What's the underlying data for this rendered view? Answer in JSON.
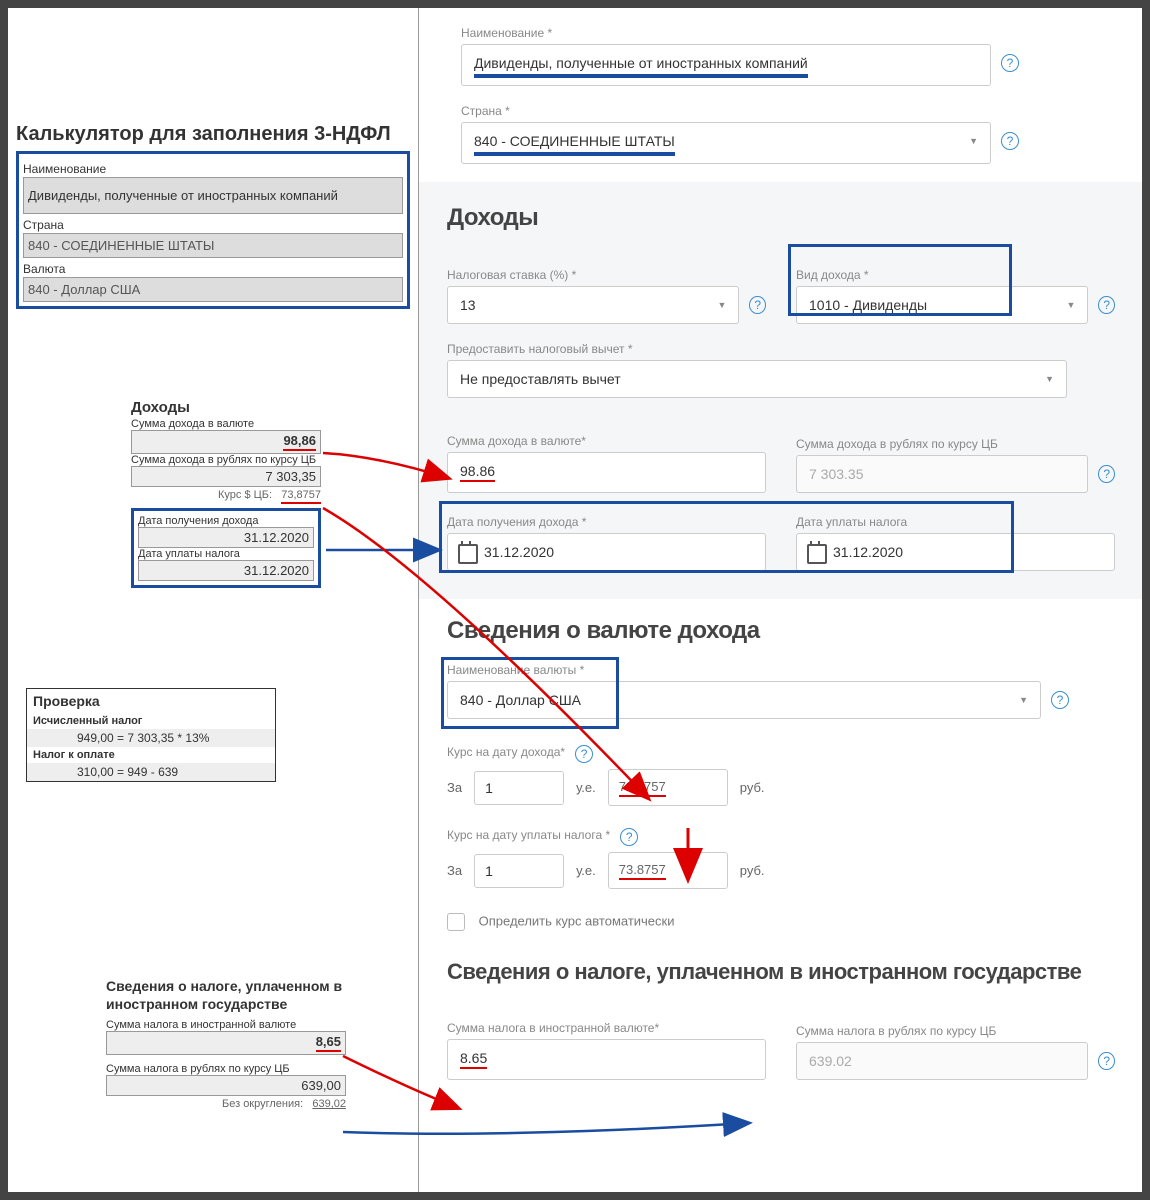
{
  "left": {
    "title": "Калькулятор для заполнения 3-НДФЛ",
    "name_lbl": "Наименование",
    "name_val": "Дивиденды, полученные от иностранных компаний",
    "country_lbl": "Страна",
    "country_val": "840 - СОЕДИНЕННЫЕ ШТАТЫ",
    "currency_lbl": "Валюта",
    "currency_val": "840 - Доллар США",
    "income_h": "Доходы",
    "sum_cur_lbl": "Сумма дохода в валюте",
    "sum_cur_val": "98,86",
    "sum_rub_lbl": "Сумма дохода в рублях по курсу ЦБ",
    "sum_rub_val": "7 303,35",
    "rate_lbl": "Курс $ ЦБ:",
    "rate_val": "73,8757",
    "date_in_lbl": "Дата получения дохода",
    "date_in_val": "31.12.2020",
    "date_pay_lbl": "Дата уплаты налога",
    "date_pay_val": "31.12.2020",
    "check_h": "Проверка",
    "check_calc_lbl": "Исчисленный налог",
    "check_calc": "949,00  =  7 303,35 * 13%",
    "check_due_lbl": "Налог к оплате",
    "check_due": "310,00  =  949 - 639",
    "tax_h": "Сведения о налоге, уплаченном в иностранном государстве",
    "tax_cur_lbl": "Сумма налога в иностранной валюте",
    "tax_cur_val": "8,65",
    "tax_rub_lbl": "Сумма налога в рублях по курсу ЦБ",
    "tax_rub_val": "639,00",
    "tax_noround_lbl": "Без округления:",
    "tax_noround_val": "639,02"
  },
  "right": {
    "name_lbl": "Наименование *",
    "name_val": "Дивиденды, полученные от иностранных компаний",
    "country_lbl": "Страна *",
    "country_val": "840 - СОЕДИНЕННЫЕ ШТАТЫ",
    "income_h": "Доходы",
    "rate_pct_lbl": "Налоговая ставка (%) *",
    "rate_pct_val": "13",
    "kind_lbl": "Вид дохода *",
    "kind_val": "1010 - Дивиденды",
    "deduct_lbl": "Предоставить налоговый вычет *",
    "deduct_val": "Не предоставлять вычет",
    "sum_cur_lbl": "Сумма дохода в валюте*",
    "sum_cur_val": "98.86",
    "sum_rub_lbl": "Сумма дохода в рублях по курсу ЦБ",
    "sum_rub_val": "7 303.35",
    "date_in_lbl": "Дата получения дохода *",
    "date_in_val": "31.12.2020",
    "date_pay_lbl": "Дата уплаты налога",
    "date_pay_val": "31.12.2020",
    "curinfo_h": "Сведения о валюте дохода",
    "curname_lbl": "Наименование валюты *",
    "curname_val": "840 - Доллар США",
    "rate_in_lbl": "Курс на дату дохода*",
    "rate_pay_lbl": "Курс на дату уплаты налога *",
    "za": "За",
    "one": "1",
    "ue": "у.е.",
    "rate_val": "73.8757",
    "rub": "руб.",
    "auto_lbl": "Определить курс автоматически",
    "tax_h": "Сведения о налоге, уплаченном в иностранном государстве",
    "tax_cur_lbl": "Сумма налога в иностранной валюте*",
    "tax_cur_val": "8.65",
    "tax_rub_lbl": "Сумма налога в рублях по курсу ЦБ",
    "tax_rub_val": "639.02"
  }
}
